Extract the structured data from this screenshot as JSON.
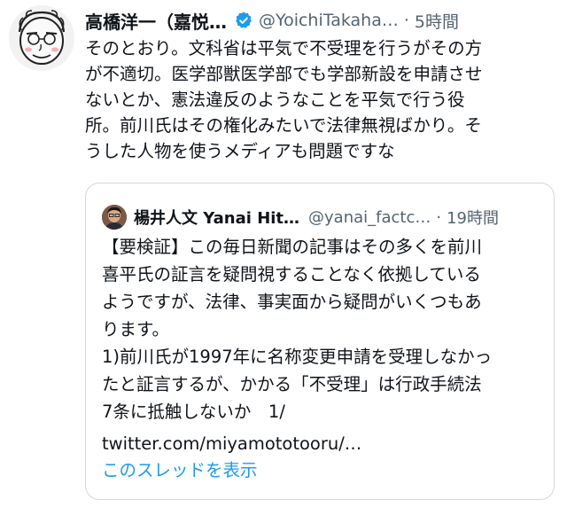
{
  "tweet": {
    "author": {
      "display_name": "高橋洋一（嘉悦…",
      "handle": "@YoichiTakaha…",
      "verified_icon": "verified-badge-icon"
    },
    "separator": "·",
    "time": "5時間",
    "text": "そのとおり。文科省は平気で不受理を行うがその方\nが不適切。医学部獣医学部でも学部新設を申請させ\nないとか、憲法違反のようなことを平気で行う役\n所。前川氏はその権化みたいで法律無視ばかり。そ\nうした人物を使うメディアも問題ですな"
  },
  "quoted_tweet": {
    "author": {
      "display_name": "楊井人文 Yanai Hit…",
      "handle": "@yanai_factc…"
    },
    "separator": "·",
    "time": "19時間",
    "text": "【要検証】この毎日新聞の記事はその多くを前川\n喜平氏の証言を疑問視することなく依拠している\nようですが、法律、事実面から疑問がいくつもあ\nります。\n1)前川氏が1997年に名称変更申請を受理しなかっ\nたと証言するが、かかる「不受理」は行政手続法\n7条に抵触しないか　1/",
    "link_text": "twitter.com/miyamototooru/…",
    "show_thread_label": "このスレッドを表示"
  },
  "colors": {
    "text": "#0f1419",
    "secondary": "#536471",
    "link_blue": "#1d9bf0",
    "border": "#cfd9de"
  }
}
